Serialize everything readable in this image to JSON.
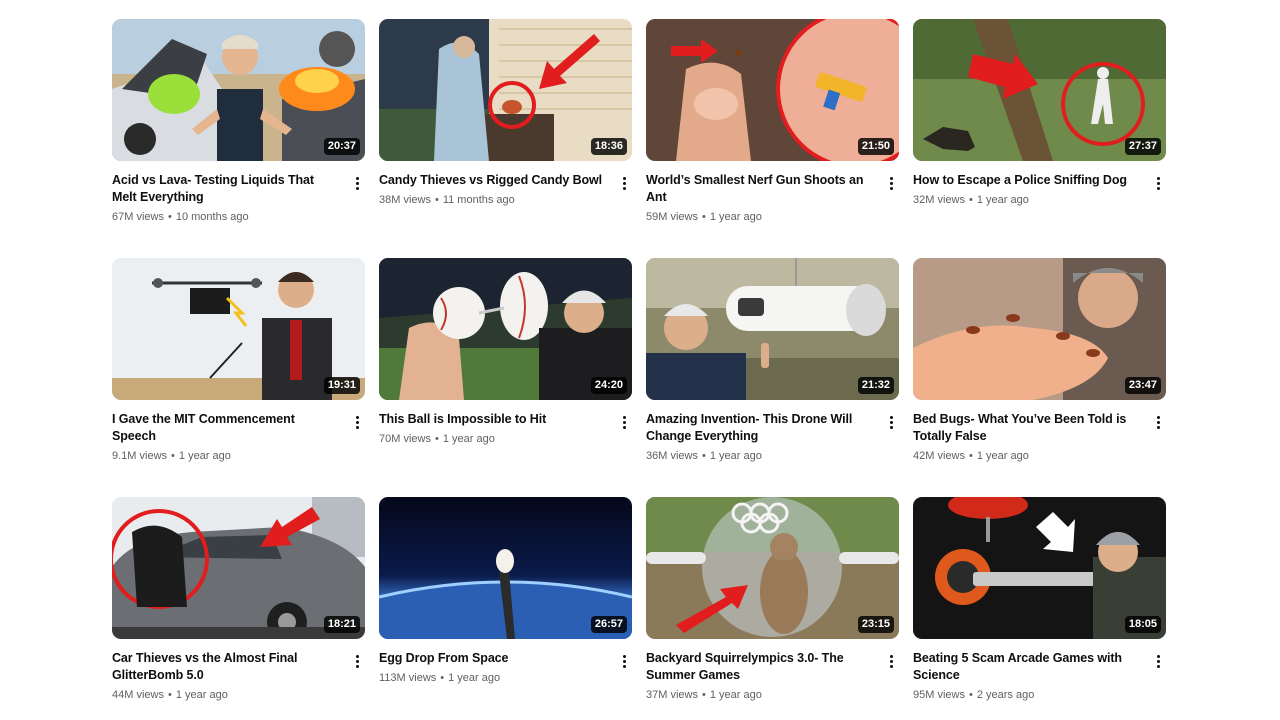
{
  "videos": [
    {
      "title": "Acid vs Lava- Testing Liquids That Melt Everything",
      "views": "67M views",
      "age": "10 months ago",
      "duration": "20:37",
      "thumb_icon": "cars-acid-lava-icon"
    },
    {
      "title": "Candy Thieves vs Rigged Candy Bowl",
      "views": "38M views",
      "age": "11 months ago",
      "duration": "18:36",
      "thumb_icon": "porch-candy-bowl-icon"
    },
    {
      "title": "World’s Smallest Nerf Gun Shoots an Ant",
      "views": "59M views",
      "age": "1 year ago",
      "duration": "21:50",
      "thumb_icon": "tiny-nerf-gun-icon"
    },
    {
      "title": "How to Escape a Police Sniffing Dog",
      "views": "32M views",
      "age": "1 year ago",
      "duration": "27:37",
      "thumb_icon": "police-dog-forest-icon"
    },
    {
      "title": "I Gave the MIT Commencement Speech",
      "views": "9.1M views",
      "age": "1 year ago",
      "duration": "19:31",
      "thumb_icon": "drone-graduation-icon"
    },
    {
      "title": "This Ball is Impossible to Hit",
      "views": "70M views",
      "age": "1 year ago",
      "duration": "24:20",
      "thumb_icon": "baseball-split-icon"
    },
    {
      "title": "Amazing Invention- This Drone Will Change Everything",
      "views": "36M views",
      "age": "1 year ago",
      "duration": "21:32",
      "thumb_icon": "zipline-drone-icon"
    },
    {
      "title": "Bed Bugs- What You’ve Been Told is Totally False",
      "views": "42M views",
      "age": "1 year ago",
      "duration": "23:47",
      "thumb_icon": "bed-bugs-arm-icon"
    },
    {
      "title": "Car Thieves vs the Almost Final GlitterBomb 5.0",
      "views": "44M views",
      "age": "1 year ago",
      "duration": "18:21",
      "thumb_icon": "car-thief-icon"
    },
    {
      "title": "Egg Drop From Space",
      "views": "113M views",
      "age": "1 year ago",
      "duration": "26:57",
      "thumb_icon": "egg-space-icon"
    },
    {
      "title": "Backyard Squirrelympics 3.0- The Summer Games",
      "views": "37M views",
      "age": "1 year ago",
      "duration": "23:15",
      "thumb_icon": "squirrel-olympics-icon"
    },
    {
      "title": "Beating 5 Scam Arcade Games with Science",
      "views": "95M views",
      "age": "2 years ago",
      "duration": "18:05",
      "thumb_icon": "arcade-claw-icon"
    }
  ],
  "colors": {
    "title": "#0f0f0f",
    "meta": "#606060",
    "duration_bg": "#000000",
    "accent_red": "#e11d1d"
  }
}
